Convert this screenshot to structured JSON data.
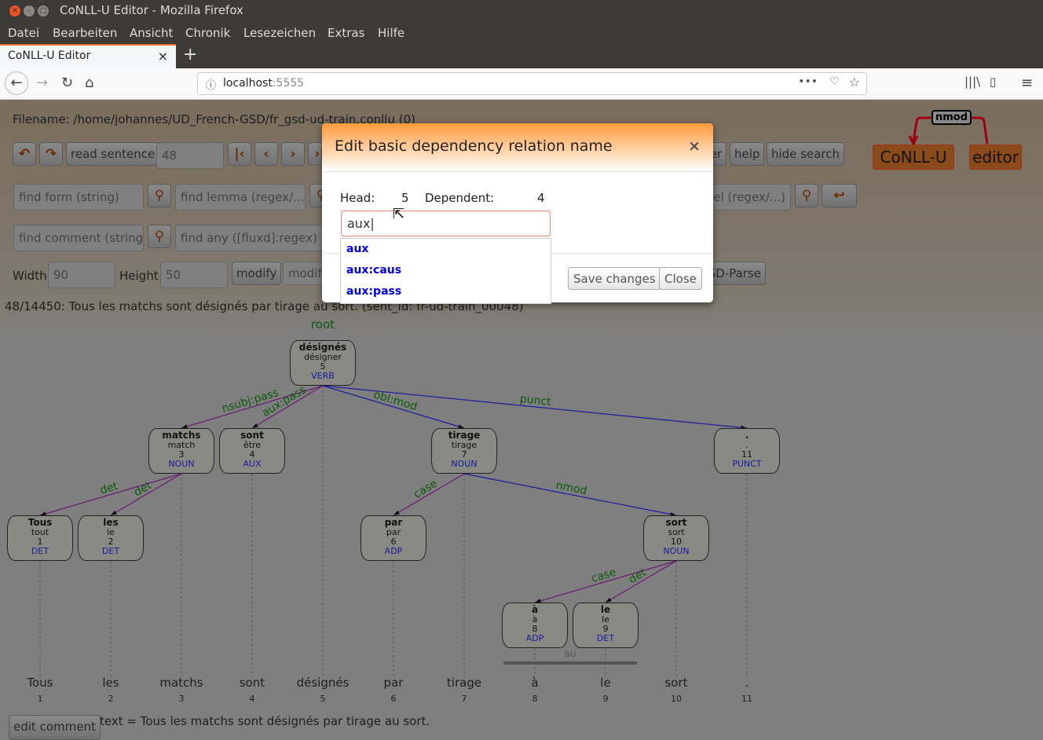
{
  "window": {
    "title": "CoNLL-U Editor - Mozilla Firefox"
  },
  "menu": [
    "Datei",
    "Bearbeiten",
    "Ansicht",
    "Chronik",
    "Lesezeichen",
    "Extras",
    "Hilfe"
  ],
  "tab": {
    "label": "CoNLL-U Editor",
    "close": "×",
    "new": "+"
  },
  "url": {
    "host": "localhost",
    "port": ":5555"
  },
  "page": {
    "filename": "Filename: /home/johannes/UD_French-GSD/fr_gsd-ud-train.conllu (0)",
    "read_sentence": "read sentence",
    "sentence_number": "48",
    "help": "help",
    "hide_search": "hide search",
    "partial_button": "er",
    "find_form": "find form (string)",
    "find_lemma": "find lemma (regex/...)",
    "find_deprel": "rel (regex/...)",
    "find_comment": "find comment (string)",
    "find_any": "find any ([fluxd]:regex)",
    "width_label": "Width",
    "width_value": "90",
    "height_label": "Height",
    "height_value": "50",
    "modify": "modify",
    "modify2": "modify",
    "sdparse": "SD-Parse",
    "sentence_info": "48/14450: Tous les matchs sont désignés par tirage au sort. (sent_id: fr-ud-train_00048)",
    "edit_comment": "edit comment",
    "text_comment": "text = Tous les matchs sont désignés par tirage au sort."
  },
  "logo": {
    "relation": "nmod",
    "word1": "CoNLL-U",
    "word2": "editor"
  },
  "modal": {
    "title": "Edit basic dependency relation name",
    "head_label": "Head:",
    "head_value": "5",
    "dependent_label": "Dependent:",
    "dependent_value": "4",
    "input_value": "aux",
    "suggestions": [
      "aux",
      "aux:caus",
      "aux:pass"
    ],
    "save": "Save changes",
    "close": "Close"
  },
  "tree": {
    "root_label": "root",
    "tokens": [
      {
        "id": "1",
        "form": "Tous",
        "lemma": "tout",
        "upos": "DET",
        "head": 3,
        "deprel": "det"
      },
      {
        "id": "2",
        "form": "les",
        "lemma": "le",
        "upos": "DET",
        "head": 3,
        "deprel": "det"
      },
      {
        "id": "3",
        "form": "matchs",
        "lemma": "match",
        "upos": "NOUN",
        "head": 5,
        "deprel": "nsubj:pass"
      },
      {
        "id": "4",
        "form": "sont",
        "lemma": "être",
        "upos": "AUX",
        "head": 5,
        "deprel": "aux:pass"
      },
      {
        "id": "5",
        "form": "désignés",
        "lemma": "désigner",
        "upos": "VERB",
        "head": 0,
        "deprel": "root"
      },
      {
        "id": "6",
        "form": "par",
        "lemma": "par",
        "upos": "ADP",
        "head": 7,
        "deprel": "case"
      },
      {
        "id": "7",
        "form": "tirage",
        "lemma": "tirage",
        "upos": "NOUN",
        "head": 5,
        "deprel": "obl:mod"
      },
      {
        "id": "8",
        "form": "à",
        "lemma": "à",
        "upos": "ADP",
        "head": 10,
        "deprel": "case"
      },
      {
        "id": "9",
        "form": "le",
        "lemma": "le",
        "upos": "DET",
        "head": 10,
        "deprel": "det"
      },
      {
        "id": "10",
        "form": "sort",
        "lemma": "sort",
        "upos": "NOUN",
        "head": 7,
        "deprel": "nmod"
      },
      {
        "id": "11",
        "form": ".",
        "lemma": ".",
        "upos": "PUNCT",
        "head": 5,
        "deprel": "punct"
      }
    ],
    "multiword": {
      "form": "au",
      "range": [
        8,
        9
      ]
    },
    "colors": {
      "left_edge": "#6a1a72",
      "right_edge": "#1a1aa0",
      "label": "#0b5a0b",
      "pos": "#1a1a9e"
    }
  }
}
